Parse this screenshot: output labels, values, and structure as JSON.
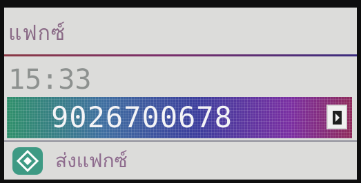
{
  "screen": {
    "title": "แฟกซ์",
    "time": "15:33",
    "fax_number": "9026700678",
    "send_label": "ส่งแฟกซ์"
  },
  "icons": {
    "field_arrow": "arrow-right-box-icon",
    "start": "diamond-start-icon"
  },
  "colors": {
    "lcd_bg": "#dcdcda",
    "accent_purple": "#7a2fa2",
    "accent_teal": "#3e9a84",
    "text_muted": "#8d918f"
  }
}
